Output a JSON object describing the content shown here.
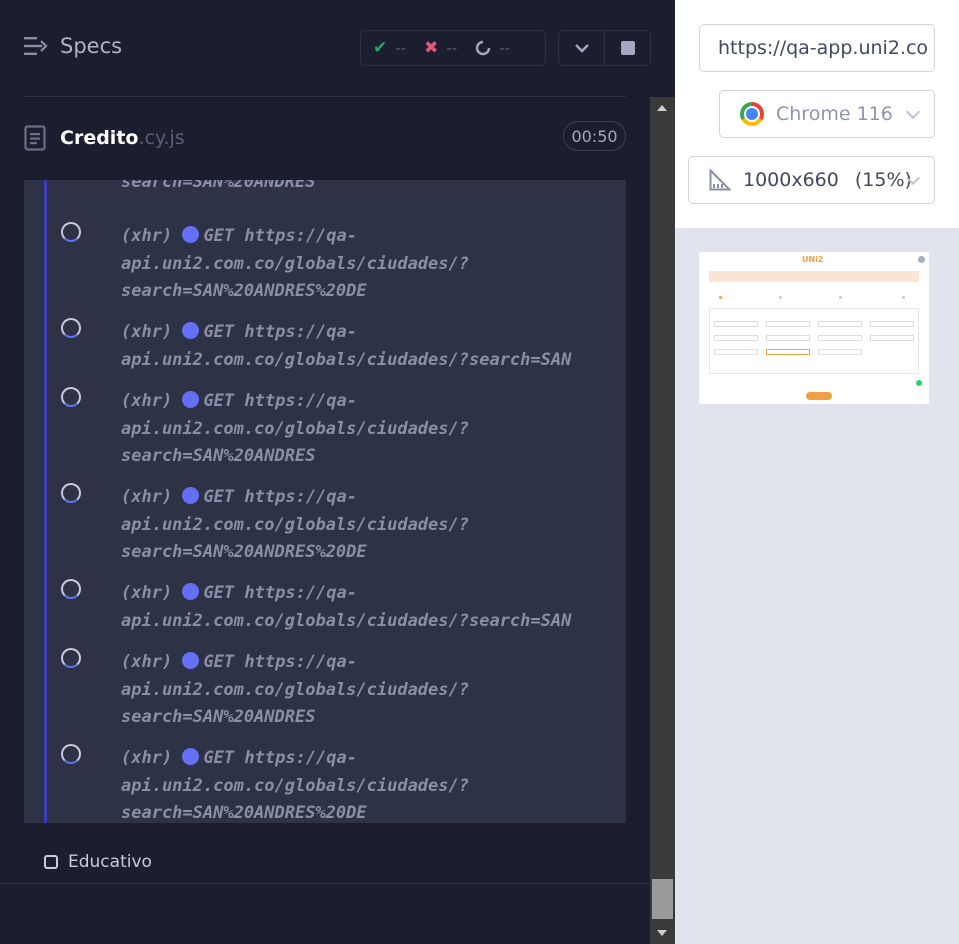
{
  "header": {
    "specs_label": "Specs",
    "passed": "--",
    "failed": "--",
    "pending": "--"
  },
  "spec": {
    "name": "Credito",
    "ext": ".cy.js",
    "timer": "00:50"
  },
  "commands": {
    "top_fragment": "search=SAN%20ANDRES",
    "items": [
      {
        "type": "(xhr)",
        "method": "GET",
        "lines": [
          "https://qa-",
          "api.uni2.com.co/globals/ciudades/?",
          "search=SAN%20ANDRES%20DE"
        ]
      },
      {
        "type": "(xhr)",
        "method": "GET",
        "lines": [
          "https://qa-",
          "api.uni2.com.co/globals/ciudades/?search=SAN"
        ]
      },
      {
        "type": "(xhr)",
        "method": "GET",
        "lines": [
          "https://qa-",
          "api.uni2.com.co/globals/ciudades/?",
          "search=SAN%20ANDRES"
        ]
      },
      {
        "type": "(xhr)",
        "method": "GET",
        "lines": [
          "https://qa-",
          "api.uni2.com.co/globals/ciudades/?",
          "search=SAN%20ANDRES%20DE"
        ]
      },
      {
        "type": "(xhr)",
        "method": "GET",
        "lines": [
          "https://qa-",
          "api.uni2.com.co/globals/ciudades/?search=SAN"
        ]
      },
      {
        "type": "(xhr)",
        "method": "GET",
        "lines": [
          "https://qa-",
          "api.uni2.com.co/globals/ciudades/?",
          "search=SAN%20ANDRES"
        ]
      },
      {
        "type": "(xhr)",
        "method": "GET",
        "lines": [
          "https://qa-",
          "api.uni2.com.co/globals/ciudades/?",
          "search=SAN%20ANDRES%20DE"
        ]
      }
    ]
  },
  "suite": {
    "educativo_label": "Educativo"
  },
  "aut": {
    "url": "https://qa-app.uni2.co",
    "browser": "Chrome 116",
    "viewport": "1000x660",
    "scale": "(15%)"
  },
  "preview": {
    "logo": "UNi2",
    "accent": "#f0a143"
  },
  "colors": {
    "accent_indigo": "#6470f3",
    "pass": "#1fa971",
    "fail": "#e45770",
    "bg": "#1b1e2e"
  }
}
